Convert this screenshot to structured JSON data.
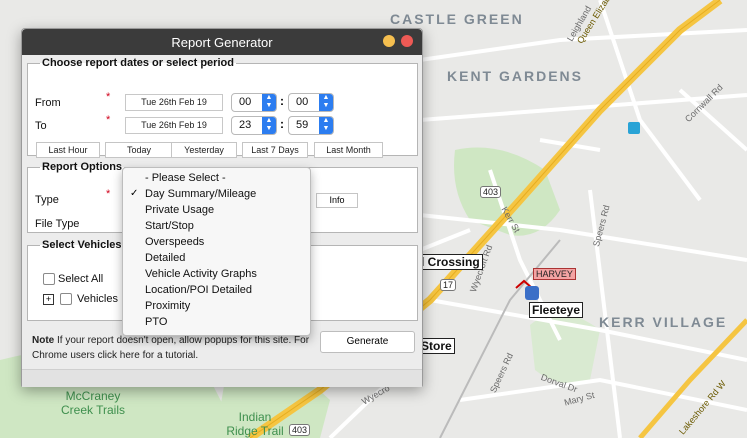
{
  "map": {
    "areas": [
      "CASTLE GREEN",
      "KENT GARDENS",
      "KERR VILLAGE"
    ],
    "parks": [
      "McCraney",
      "Creek Trails",
      "Indian",
      "Ridge Trail"
    ],
    "streets": [
      "Queen Elizabeth Way",
      "Leighland",
      "Cornwall Rd",
      "Kerr St",
      "Speers Rd",
      "Wyecroft Rd",
      "Dorval Dr",
      "Mary St",
      "Lakeshore Rd W",
      "Wyecro"
    ],
    "shields": [
      "403",
      "17",
      "403"
    ],
    "poi_tags": [
      "l Crossing",
      "Store",
      "Fleeteye"
    ],
    "vehicle_label": "HARVEY",
    "colors": {
      "land": "#e8e8e6",
      "park": "#cfe7c3",
      "highway": "#f5c542",
      "road": "#ffffff"
    }
  },
  "dialog": {
    "title": "Report Generator",
    "dates": {
      "legend": "Choose report dates or select period",
      "from_label": "From",
      "to_label": "To",
      "required_mark": "*",
      "from_date": "Tue 26th Feb 19",
      "from_hour": "00",
      "from_minute": "00",
      "to_date": "Tue 26th Feb 19",
      "to_hour": "23",
      "to_minute": "59",
      "colon": ":",
      "quick_buttons": [
        "Last Hour",
        "Today",
        "Yesterday",
        "Last 7 Days",
        "Last Month"
      ]
    },
    "options": {
      "legend": "Report Options",
      "type_label": "Type",
      "file_type_label": "File Type",
      "info_button": "Info"
    },
    "vehicles": {
      "legend": "Select Vehicles",
      "select_all": "Select All",
      "plus": "+",
      "vehicles_label": "Vehicles"
    },
    "note_bold": "Note",
    "note_text": " If your report doesn't open, allow popups for this site. For Chrome users click here for a tutorial.",
    "generate_button": "Generate"
  },
  "dropdown": {
    "selected_index": 1,
    "check_mark": "✓",
    "options": [
      "- Please Select -",
      "Day Summary/Mileage",
      "Private Usage",
      "Start/Stop",
      "Overspeeds",
      "Detailed",
      "Vehicle Activity Graphs",
      "Location/POI Detailed",
      "Proximity",
      "PTO"
    ]
  }
}
